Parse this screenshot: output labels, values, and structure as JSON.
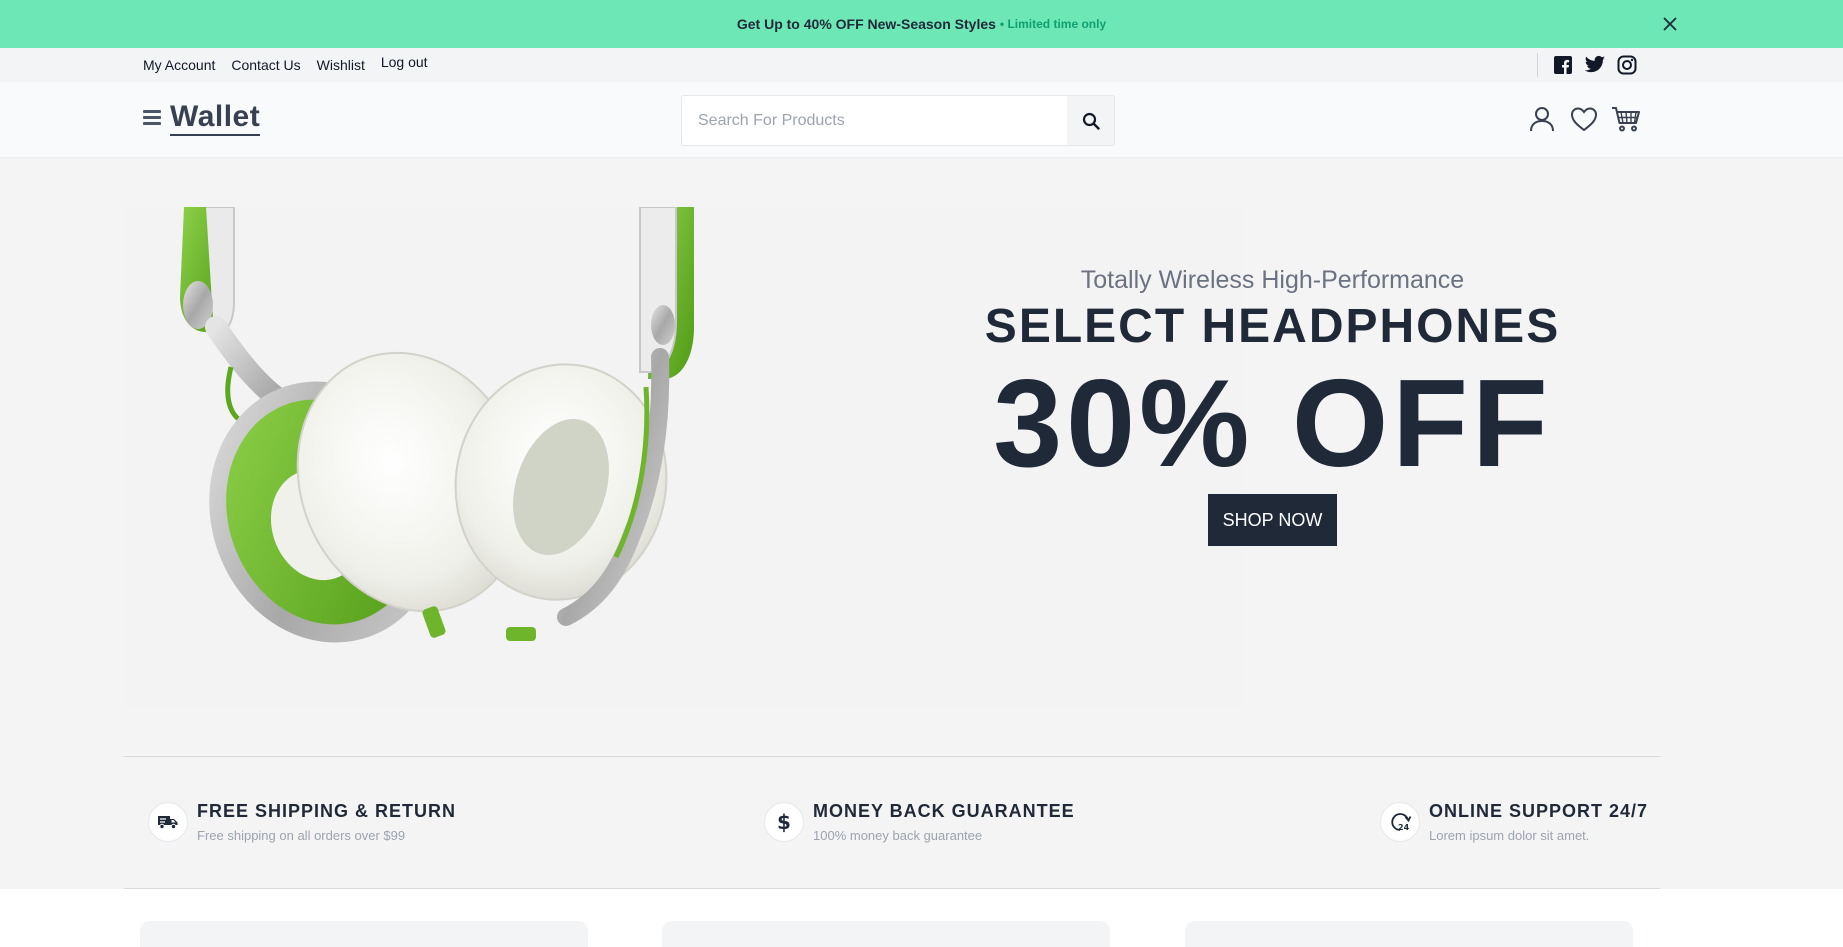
{
  "promo": {
    "text": "Get Up to 40% OFF New-Season Styles",
    "sub": "• Limited time only",
    "close_icon": "close-icon"
  },
  "utility_nav": {
    "links": [
      "My Account",
      "Contact Us",
      "Wishlist",
      "Log out"
    ],
    "social": [
      "facebook-icon",
      "twitter-icon",
      "instagram-icon"
    ]
  },
  "header": {
    "logo": "Wallet",
    "search": {
      "placeholder": "Search For Products",
      "value": ""
    },
    "icons": [
      "account-icon",
      "wishlist-icon",
      "cart-icon"
    ]
  },
  "hero": {
    "subtitle": "Totally Wireless High-Performance",
    "title": "SELECT HEADPHONES",
    "discount": "30% OFF",
    "cta": "SHOP NOW",
    "image": "green-white-headphones"
  },
  "features": [
    {
      "icon": "truck-icon",
      "title": "FREE SHIPPING & RETURN",
      "desc": "Free shipping on all orders over $99"
    },
    {
      "icon": "dollar-icon",
      "title": "MONEY BACK GUARANTEE",
      "desc": "100% money back guarantee"
    },
    {
      "icon": "support-24-icon",
      "title": "ONLINE SUPPORT 24/7",
      "desc": "Lorem ipsum dolor sit amet."
    }
  ],
  "colors": {
    "promo_bg": "#6ee7b7",
    "promo_accent": "#0f9f6e",
    "dark": "#1f2937",
    "headphone_green": "#6fb52c"
  }
}
